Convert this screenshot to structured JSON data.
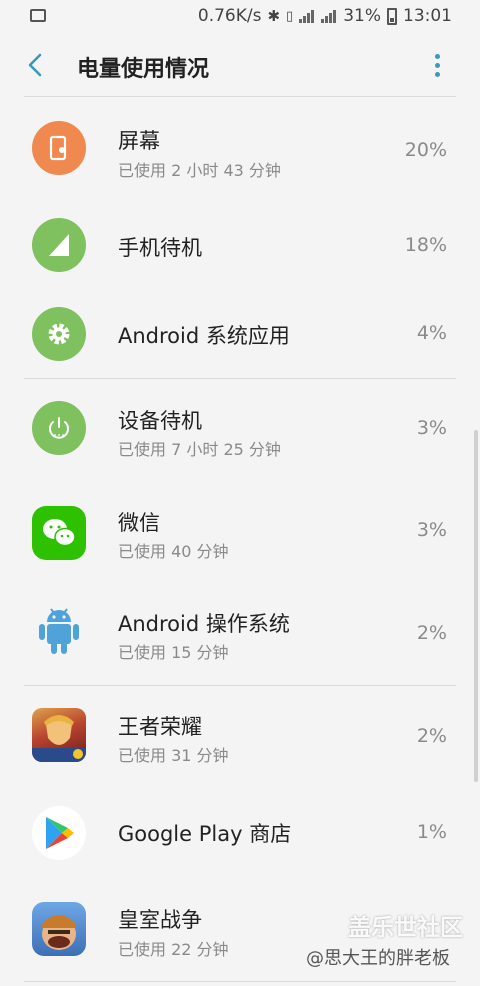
{
  "status_bar": {
    "network_speed": "0.76K/s",
    "battery": "31%",
    "time": "13:01",
    "icons": [
      "image-icon",
      "bluetooth-icon",
      "vibrate-icon",
      "4g-signal-icon",
      "signal-icon",
      "battery-icon"
    ]
  },
  "app_bar": {
    "title": "电量使用情况",
    "back_icon": "back-arrow-icon",
    "more_icon": "more-vert-icon",
    "accent": "#3a9bb5"
  },
  "items": [
    {
      "name": "屏幕",
      "usage": "已使用 2 小时 43 分钟",
      "percent": "20%",
      "icon": "screen-brightness-icon",
      "color": "#f0894f"
    },
    {
      "name": "手机待机",
      "usage": "",
      "percent": "18%",
      "icon": "signal-bars-icon",
      "color": "#7ec15e"
    },
    {
      "name": "Android 系统应用",
      "usage": "",
      "percent": "4%",
      "icon": "gear-icon",
      "color": "#7ec15e"
    },
    {
      "name": "设备待机",
      "usage": "已使用 7 小时 25 分钟",
      "percent": "3%",
      "icon": "power-icon",
      "color": "#7ec15e"
    },
    {
      "name": "微信",
      "usage": "已使用 40 分钟",
      "percent": "3%",
      "icon": "wechat-icon",
      "color": "#2dc100"
    },
    {
      "name": "Android 操作系统",
      "usage": "已使用 15 分钟",
      "percent": "2%",
      "icon": "android-robot-icon",
      "color": "#4fa3d9"
    },
    {
      "name": "王者荣耀",
      "usage": "已使用 31 分钟",
      "percent": "2%",
      "icon": "game-icon",
      "color": "#c0392b"
    },
    {
      "name": "Google Play 商店",
      "usage": "",
      "percent": "1%",
      "icon": "google-play-icon",
      "color": "#ffffff"
    },
    {
      "name": "皇室战争",
      "usage": "已使用 22 分钟",
      "percent": "",
      "icon": "clash-royale-icon",
      "color": "#5b8ed0"
    }
  ],
  "watermark": {
    "brand": "盖乐世社区",
    "author": "@思大王的胖老板"
  }
}
